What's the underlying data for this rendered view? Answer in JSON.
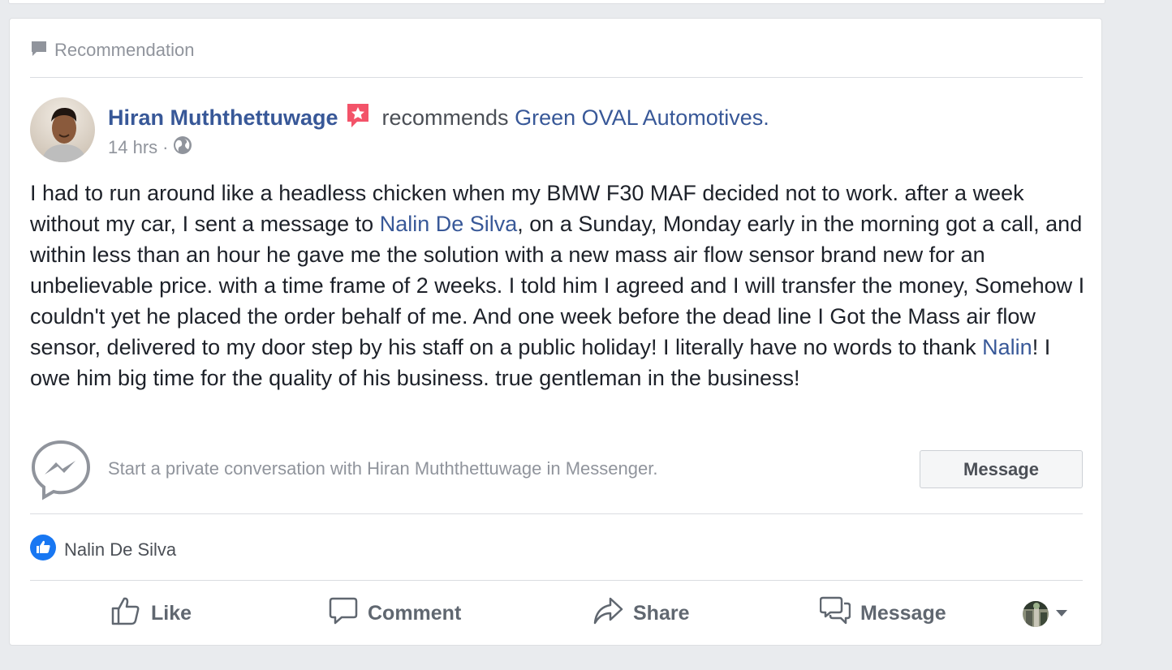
{
  "post": {
    "section_label": "Recommendation",
    "author": "Hiran Muththettuwage",
    "verb": "recommends",
    "target": "Green OVAL Automotives",
    "target_suffix": ".",
    "time": "14 hrs",
    "separator": "·",
    "body": {
      "p1": "I had to run around like a headless chicken when my BMW F30 MAF decided not to work. after a week without my car, I sent a message to ",
      "mention1": "Nalin De Silva",
      "p2": ", on a Sunday, Monday early in the morning got a call, and within less than an hour he gave me the solution with a new mass air flow sensor brand new for an unbelievable price. with a time frame of 2 weeks. I told him I agreed and I will transfer the money, Somehow I couldn't yet he placed the order behalf of me. And one week before the dead line I Got the Mass air flow sensor, delivered to my door step by his staff on a public holiday! I literally have no words to thank ",
      "mention2": "Nalin",
      "p3": "! I owe him big time for the quality of his business. true gentleman in the business!"
    }
  },
  "messenger": {
    "prompt": "Start a private conversation with Hiran Muththettuwage in Messenger.",
    "button_label": "Message"
  },
  "reactions": {
    "names": "Nalin De Silva"
  },
  "actions": {
    "like": "Like",
    "comment": "Comment",
    "share": "Share",
    "message": "Message"
  },
  "colors": {
    "link": "#385898",
    "muted": "#90949c",
    "text": "#1d2129",
    "accent_blue": "#1877f2",
    "badge_pink": "#f35369"
  },
  "icons": {
    "header": "comment-bubble-icon",
    "badge": "star-badge-icon",
    "privacy": "globe-icon",
    "messenger": "messenger-icon",
    "reaction": "like-reaction-icon",
    "like": "thumbs-up-icon",
    "comment": "comment-icon",
    "share": "share-icon",
    "message": "message-icon",
    "dropdown": "caret-down-icon"
  }
}
